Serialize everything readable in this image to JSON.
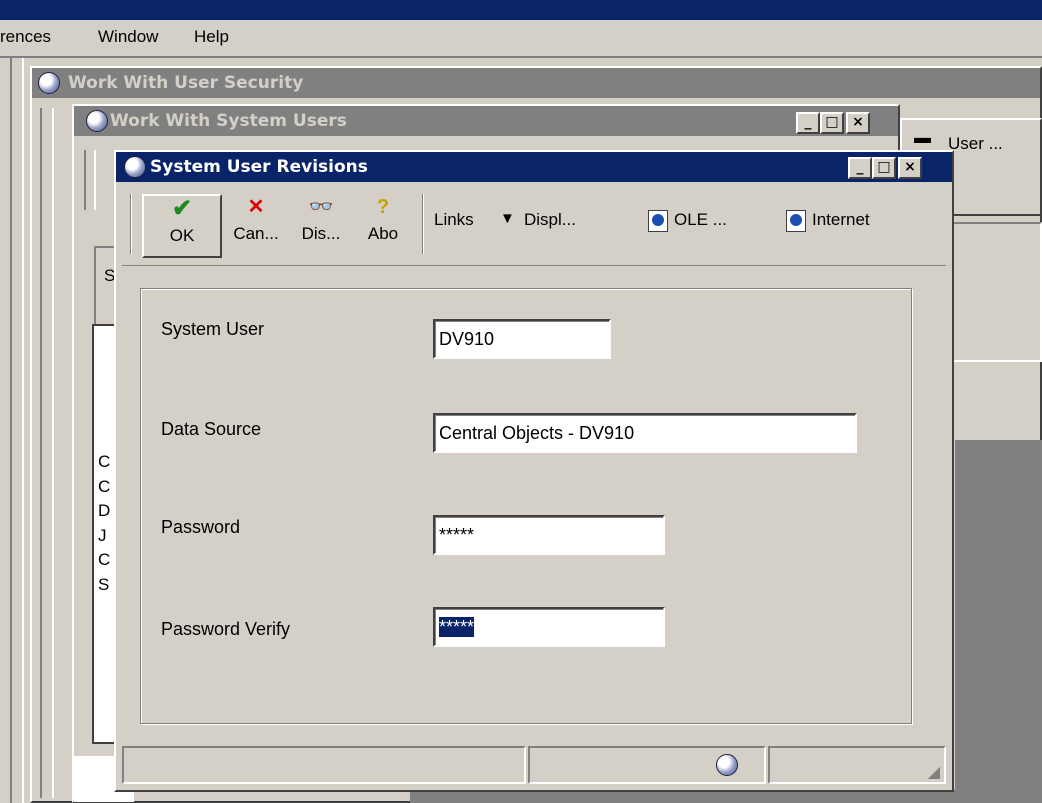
{
  "menu": [
    "rences",
    "Window",
    "Help"
  ],
  "windows": {
    "user_security": {
      "title": "Work With User Security"
    },
    "system_users": {
      "title": "Work With System Users",
      "right_label": "User ...",
      "left_fragment": "S",
      "list_letters": [
        "C",
        "C",
        "D",
        "J",
        "C",
        "S"
      ]
    },
    "revisions": {
      "title": "System User Revisions",
      "toolbar": {
        "ok": "OK",
        "cancel": "Can...",
        "display": "Dis...",
        "about": "Abo",
        "links": "Links",
        "display_dropdown": "Displ...",
        "ole": "OLE ...",
        "internet": "Internet"
      },
      "form": {
        "system_user_label": "System User",
        "system_user_value": "DV910",
        "data_source_label": "Data Source",
        "data_source_value": "Central Objects - DV910",
        "password_label": "Password",
        "password_value": "*****",
        "password_verify_label": "Password Verify",
        "password_verify_value": "*****"
      }
    }
  },
  "colors": {
    "title_active": "#0a246a",
    "title_inactive": "#808080",
    "face": "#d4d0c8"
  }
}
